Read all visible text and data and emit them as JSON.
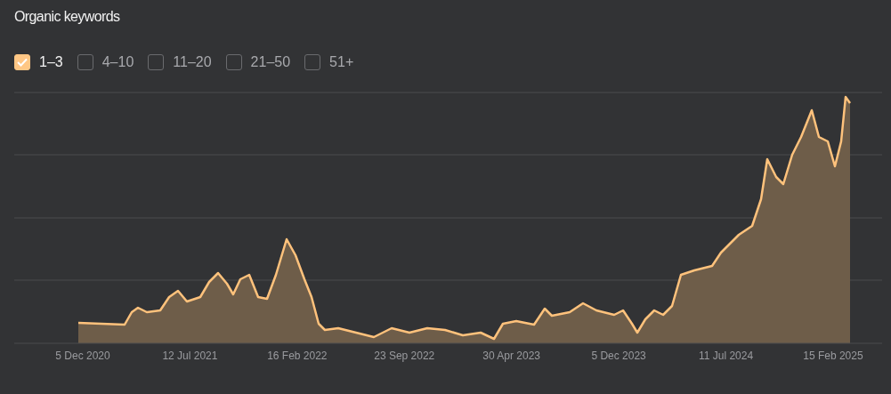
{
  "title": "Organic keywords",
  "filters": [
    {
      "label": "1–3",
      "checked": true
    },
    {
      "label": "4–10",
      "checked": false
    },
    {
      "label": "11–20",
      "checked": false
    },
    {
      "label": "21–50",
      "checked": false
    },
    {
      "label": "51+",
      "checked": false
    }
  ],
  "x_labels": [
    "5 Dec 2020",
    "12 Jul 2021",
    "16 Feb 2022",
    "23 Sep 2022",
    "30 Apr 2023",
    "5 Dec 2023",
    "11 Jul 2024",
    "15 Feb 2025"
  ]
}
